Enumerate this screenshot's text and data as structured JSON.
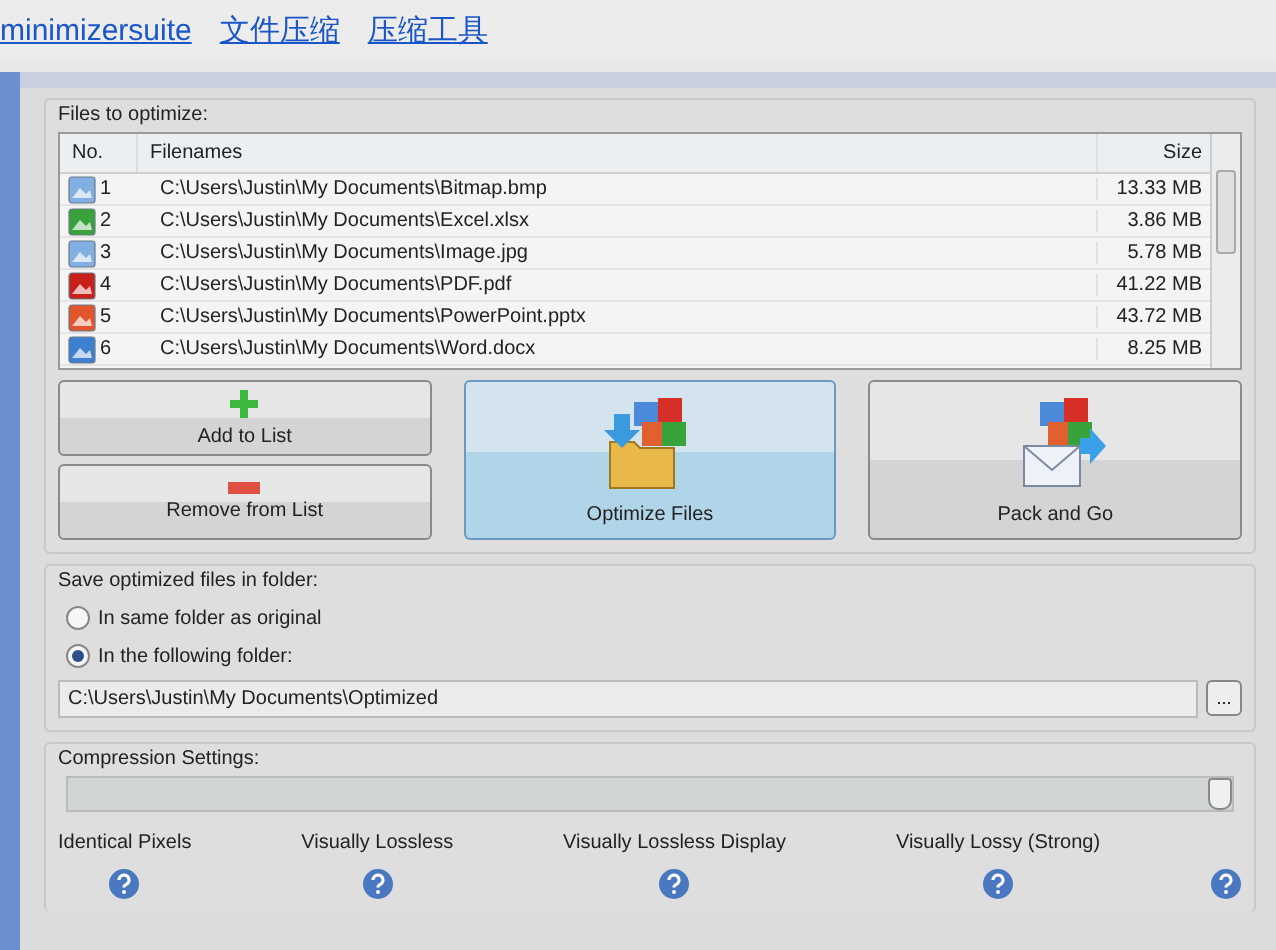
{
  "header_links": [
    "minimizersuite",
    "文件压缩",
    "压缩工具"
  ],
  "files": {
    "title": "Files to optimize:",
    "columns": [
      "No.",
      "Filenames",
      "Size"
    ],
    "rows": [
      {
        "no": "1",
        "kind": "image",
        "filename": "C:\\Users\\Justin\\My Documents\\Bitmap.bmp",
        "size": "13.33 MB"
      },
      {
        "no": "2",
        "kind": "excel",
        "filename": "C:\\Users\\Justin\\My Documents\\Excel.xlsx",
        "size": "3.86 MB"
      },
      {
        "no": "3",
        "kind": "image",
        "filename": "C:\\Users\\Justin\\My Documents\\Image.jpg",
        "size": "5.78 MB"
      },
      {
        "no": "4",
        "kind": "pdf",
        "filename": "C:\\Users\\Justin\\My Documents\\PDF.pdf",
        "size": "41.22 MB"
      },
      {
        "no": "5",
        "kind": "powerpoint",
        "filename": "C:\\Users\\Justin\\My Documents\\PowerPoint.pptx",
        "size": "43.72 MB"
      },
      {
        "no": "6",
        "kind": "word",
        "filename": "C:\\Users\\Justin\\My Documents\\Word.docx",
        "size": "8.25 MB"
      }
    ]
  },
  "actions": [
    {
      "label": "Add to List",
      "kind": "add",
      "selected": false
    },
    {
      "label": "Remove from List",
      "kind": "remove",
      "selected": false
    },
    {
      "label": "Optimize Files",
      "kind": "optimize",
      "selected": true
    },
    {
      "label": "Pack and Go",
      "kind": "pack",
      "selected": false
    }
  ],
  "save": {
    "title": "Save optimized files in folder:",
    "options": [
      {
        "label": "In same folder as original",
        "selected": false
      },
      {
        "label": "In the following folder:",
        "selected": true
      }
    ],
    "folder": "C:\\Users\\Justin\\My Documents\\Optimized",
    "browse": "..."
  },
  "compression": {
    "title": "Compression Settings:",
    "level": 1.0,
    "stops": [
      {
        "label": "Identical Pixels"
      },
      {
        "label": "Visually Lossless"
      },
      {
        "label": "Visually Lossless Display"
      },
      {
        "label": "Visually Lossy (Strong)"
      }
    ]
  }
}
